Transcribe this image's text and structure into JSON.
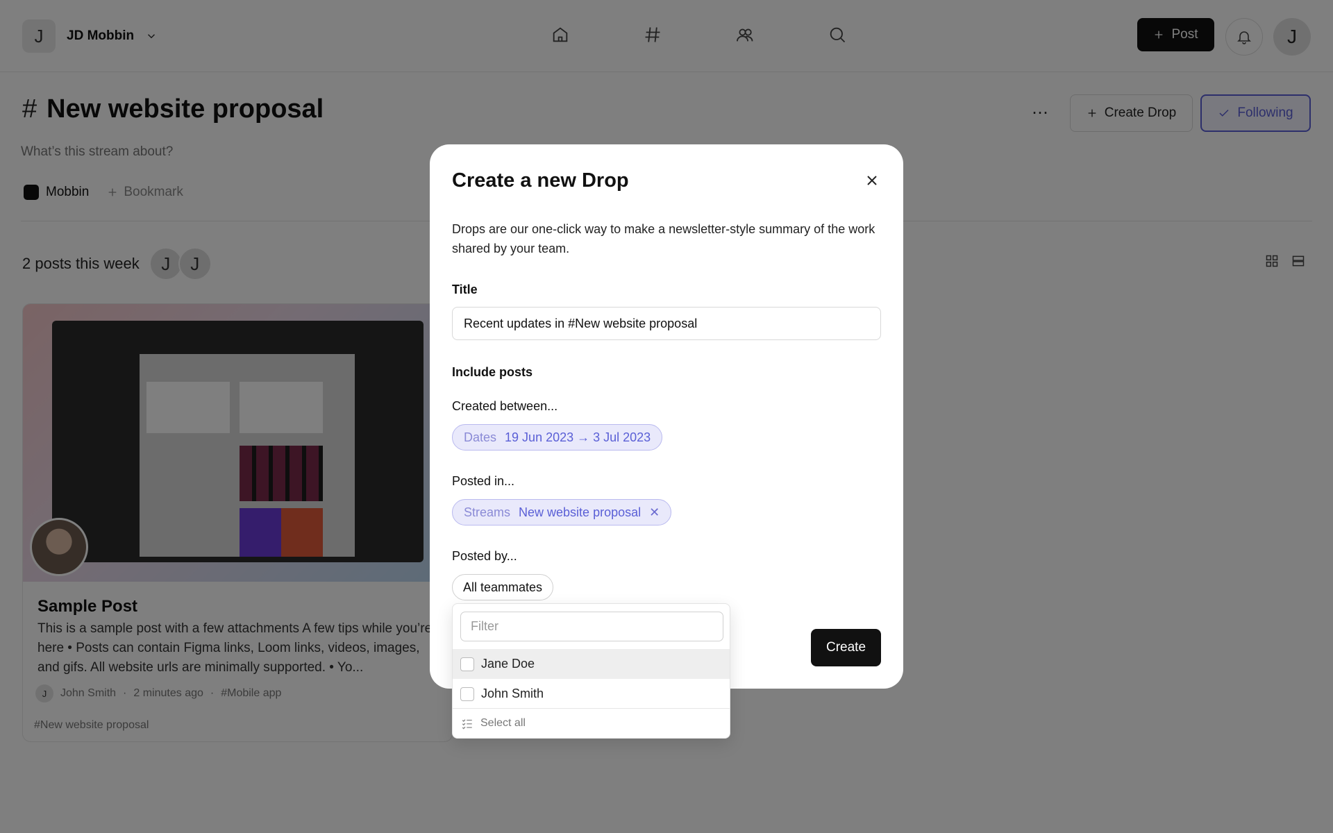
{
  "workspace": {
    "avatar_letter": "J",
    "name": "JD Mobbin"
  },
  "nav": {
    "icons": [
      "home-icon",
      "hash-icon",
      "people-icon",
      "search-icon"
    ]
  },
  "header": {
    "post_label": "Post",
    "user_letter": "J"
  },
  "stream": {
    "hash": "#",
    "title": "New website proposal",
    "description": "What’s this stream about?",
    "create_drop_label": "Create Drop",
    "following_label": "Following",
    "links": {
      "mobbin": "Mobbin",
      "bookmark": "Bookmark"
    },
    "week_summary": "2 posts this week",
    "avatar_letters": [
      "J",
      "J"
    ]
  },
  "post": {
    "title": "Sample Post",
    "body": "This is a sample post with a few attachments A few tips while you’re here  •  Posts can contain Figma links, Loom links, videos, images, and gifs. All website urls are minimally supported.  •  Yo...",
    "author_letter": "J",
    "author": "John Smith",
    "time": "2 minutes ago",
    "tag": "#Mobile app",
    "stream_tag": "#New website proposal"
  },
  "modal": {
    "title": "Create a new Drop",
    "description": "Drops are our one-click way to make a newsletter-style summary of the work shared by your team.",
    "title_label": "Title",
    "title_value": "Recent updates in #New website proposal",
    "include_label": "Include posts",
    "created_label": "Created between...",
    "dates_key": "Dates",
    "dates_value": "19 Jun 2023 → 3 Jul 2023",
    "posted_in_label": "Posted in...",
    "streams_key": "Streams",
    "streams_value": "New website proposal",
    "posted_by_label": "Posted by...",
    "teammates_label": "All teammates",
    "create_label": "Create"
  },
  "dropdown": {
    "filter_placeholder": "Filter",
    "items": [
      {
        "label": "Jane Doe",
        "checked": false
      },
      {
        "label": "John Smith",
        "checked": false
      }
    ],
    "select_all_label": "Select all"
  },
  "colors": {
    "accent": "#5a5fd6",
    "overlay": "rgba(0,0,0,0.5)"
  }
}
